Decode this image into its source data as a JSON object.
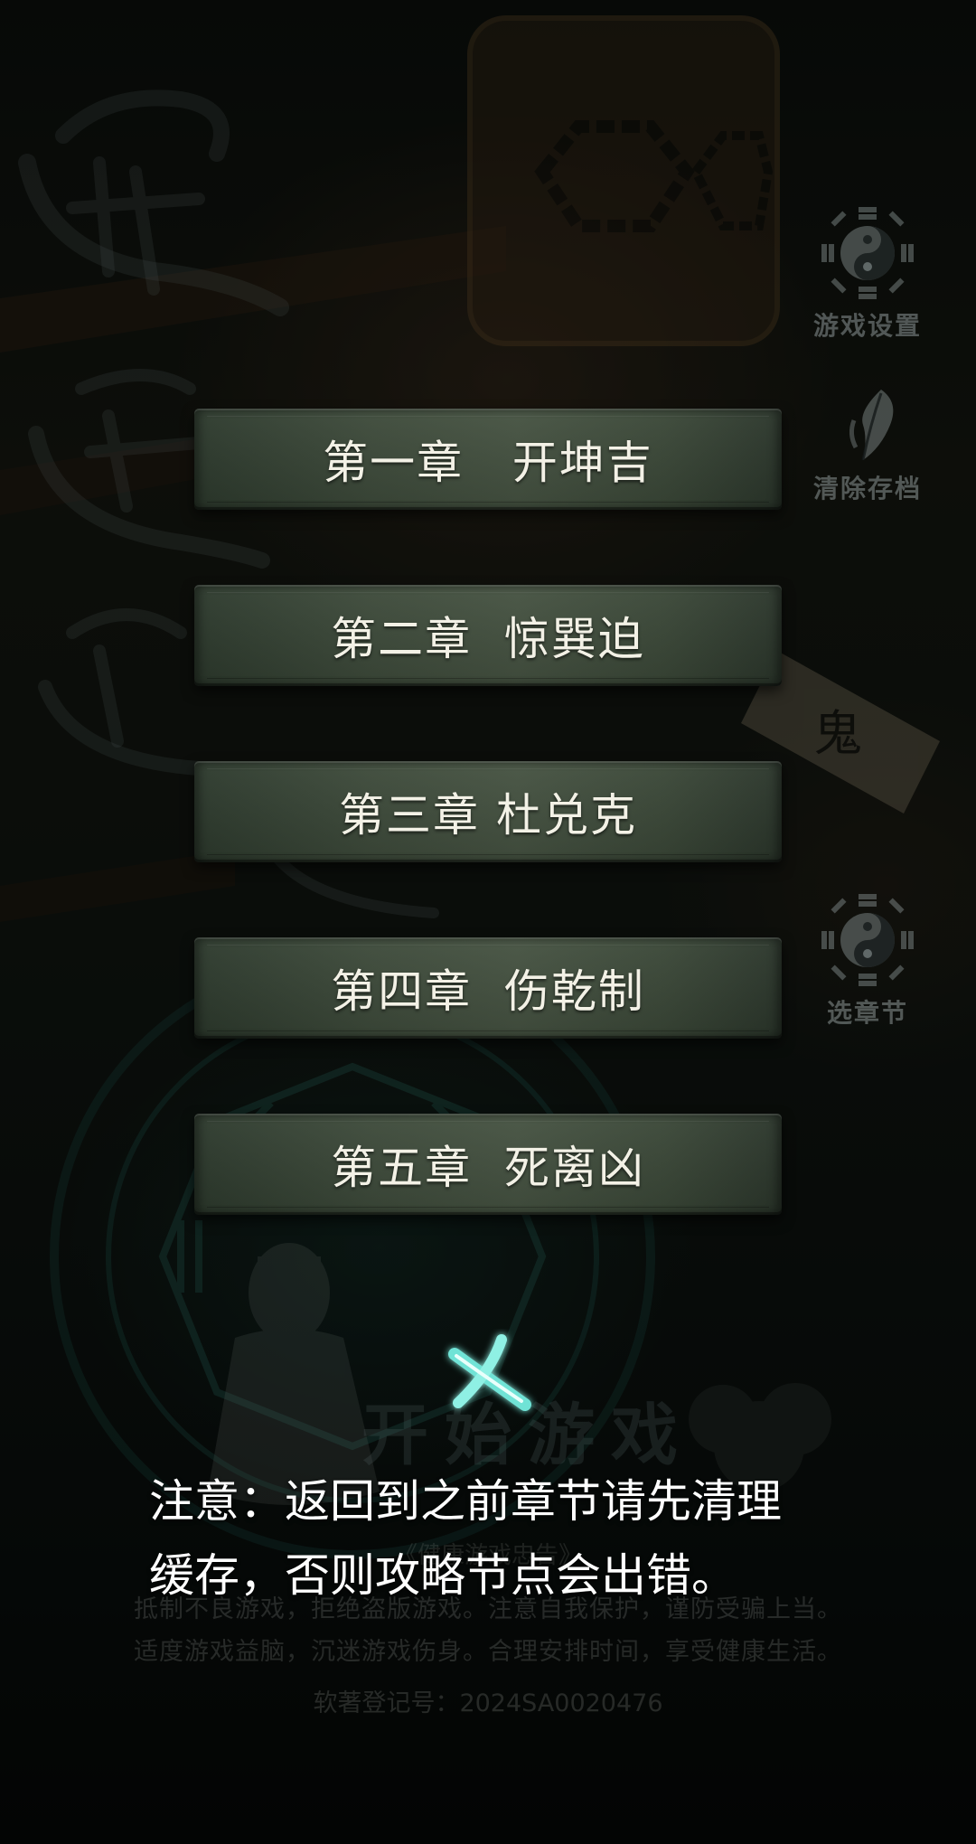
{
  "chapters": [
    {
      "label": "第一章   开坤吉"
    },
    {
      "label": "第二章  惊巽迫"
    },
    {
      "label": "第三章 杜兑克"
    },
    {
      "label": "第四章  伤乾制"
    },
    {
      "label": "第五章  死离凶"
    }
  ],
  "side_menu": {
    "settings_label": "游戏设置",
    "clear_label": "清除存档",
    "select_chapter_label": "选章节"
  },
  "background": {
    "start_game": "开始游戏",
    "health_title": "《健康游戏忠告》",
    "health_lines": [
      "抵制不良游戏，拒绝盗版游戏。注意自我保护，谨防受骗上当。",
      "适度游戏益脑，沉迷游戏伤身。合理安排时间，享受健康生活。"
    ],
    "registration": "软著登记号：2024SA0020476"
  },
  "notice": {
    "text": "注意：返回到之前章节请先清理缓存，否则攻略节点会出错。"
  },
  "colors": {
    "button": "#3e4b3b",
    "button_text": "#f3f1e6",
    "accent_teal": "#6fe3d6",
    "notice_text": "#ffffff"
  },
  "icons": {
    "settings": "taiji-bagua-icon",
    "clear": "feather-brush-icon",
    "select_chapter": "taiji-bagua-icon",
    "close": "close-x-icon"
  }
}
